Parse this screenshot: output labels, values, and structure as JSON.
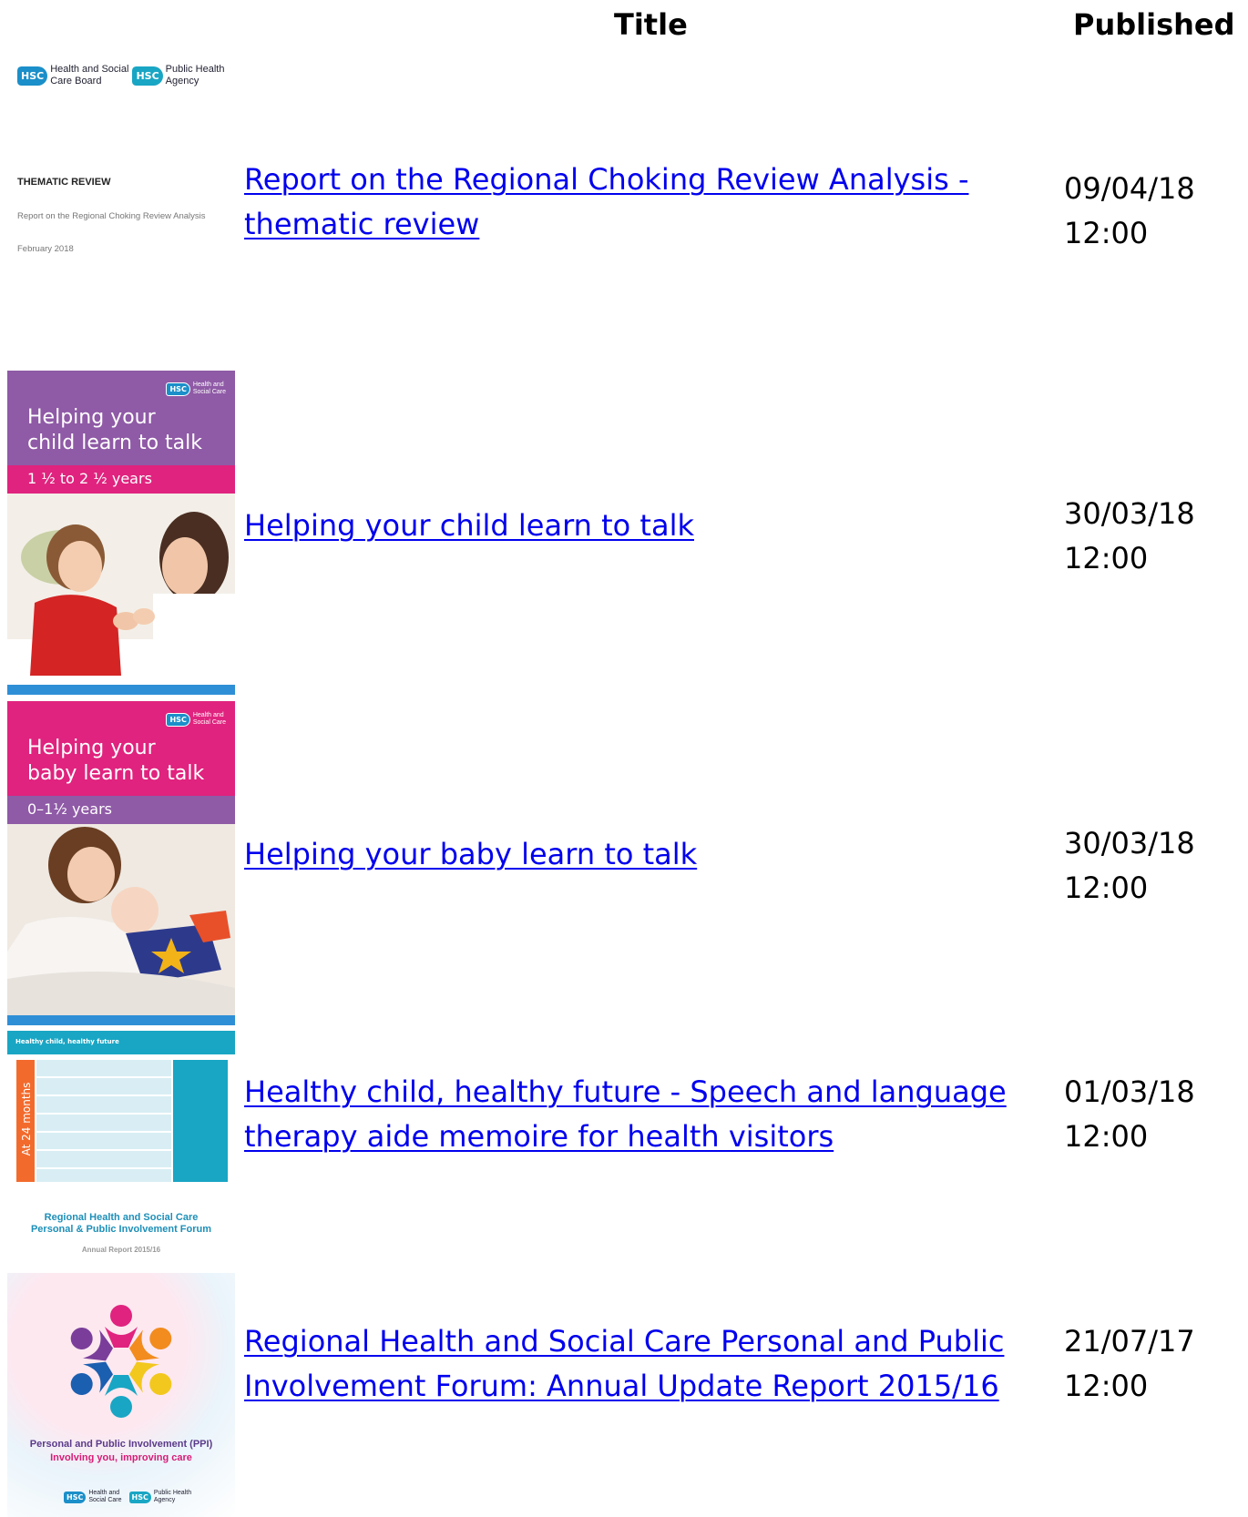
{
  "table": {
    "headers": {
      "title": "Title",
      "published": "Published"
    }
  },
  "rows": [
    {
      "title": "Report on the Regional Choking Review Analysis - thematic review",
      "published_date": "09/04/18",
      "published_time": "12:00",
      "thumbnail": {
        "logo_left_box": "HSC",
        "logo_left_line1": "Health and Social",
        "logo_left_line2": "Care Board",
        "logo_right_box": "HSC",
        "logo_right_line1": "Public Health",
        "logo_right_line2": "Agency",
        "heading": "THEMATIC REVIEW",
        "subtitle": "Report on the Regional Choking Review Analysis",
        "date": "February 2018"
      }
    },
    {
      "title": "Helping your child learn to talk",
      "published_date": "30/03/18",
      "published_time": "12:00",
      "thumbnail": {
        "logo_box": "HSC",
        "logo_line1": "Health and",
        "logo_line2": "Social Care",
        "heading_line1": "Helping your",
        "heading_line2": "child learn to talk",
        "age_band": "1 ½ to 2 ½ years",
        "primary_color": "#8f5aa6",
        "band_color": "#e0237e"
      }
    },
    {
      "title": "Helping your baby learn to talk",
      "published_date": "30/03/18",
      "published_time": "12:00",
      "thumbnail": {
        "logo_box": "HSC",
        "logo_line1": "Health and",
        "logo_line2": "Social Care",
        "heading_line1": "Helping your",
        "heading_line2": "baby learn to talk",
        "age_band": "0–1½ years",
        "primary_color": "#e0237e",
        "band_color": "#8f5aa6"
      }
    },
    {
      "title": "Healthy child, healthy future - Speech and language therapy aide memoire for health visitors",
      "published_date": "01/03/18",
      "published_time": "12:00",
      "thumbnail": {
        "header_text": "Healthy child, healthy future",
        "side_label": "At 24 months"
      }
    },
    {
      "title": "Regional Health and Social Care Personal and Public Involvement Forum: Annual Update Report 2015/16",
      "published_date": "21/07/17",
      "published_time": "12:00",
      "thumbnail": {
        "heading_line1": "Regional Health and Social Care",
        "heading_line2": "Personal & Public Involvement Forum",
        "subheading": "Annual Report 2015/16",
        "tagline1": "Personal and Public Involvement (PPI)",
        "tagline2": "Involving you, improving care",
        "logo_left_box": "HSC",
        "logo_left_line1": "Health and",
        "logo_left_line2": "Social Care",
        "logo_right_box": "HSC",
        "logo_right_line1": "Public Health",
        "logo_right_line2": "Agency"
      }
    }
  ],
  "colors": {
    "link": "#0000ee",
    "hsc_blue": "#1b8fc9",
    "hsc_teal": "#19a6c4"
  }
}
